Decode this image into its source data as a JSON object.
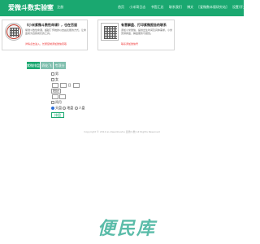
{
  "header": {
    "title": "爱微斗数实验室",
    "auth": [
      "登录",
      "注册"
    ],
    "nav": [
      "首页",
      "小米哥日志",
      "书签汇总",
      "联系我们",
      "博文",
      "[爱微数本版研究站]",
      "设置/开关"
    ]
  },
  "promos": [
    {
      "title": "《小米紫微斗数性命课》，也在百道",
      "body": "紫微斗数性命课，超越了传统的以吉凶论断的方式，让命盘成为自我成长的工具。",
      "link": "详情点击进入，长按复制添加微信索取"
    },
    {
      "title": "有意解盘、打印紫微报告的联系",
      "body": "添加小米微信，提供出生时间及具体需求，小米安排排盘、解盘服务与报告。",
      "link": "联系添加微信号"
    }
  ],
  "tabs": [
    "紫微排盘",
    "四化飞星",
    "专项分析"
  ],
  "form": {
    "gender_options": [
      "男",
      "女"
    ],
    "date_label": "日",
    "calendar_select": "阳历",
    "leap_label": "闰月",
    "mode_options": [
      "天盘",
      "地盘",
      "人盘"
    ],
    "submit_label": "排盘"
  },
  "footer": {
    "text": "Copyright © 2012 ai-ziweidoushu 爱微斗数 All Rights Reserved"
  },
  "watermark": "便民库",
  "colors": {
    "brand": "#1aa870",
    "link": "#e33333"
  }
}
